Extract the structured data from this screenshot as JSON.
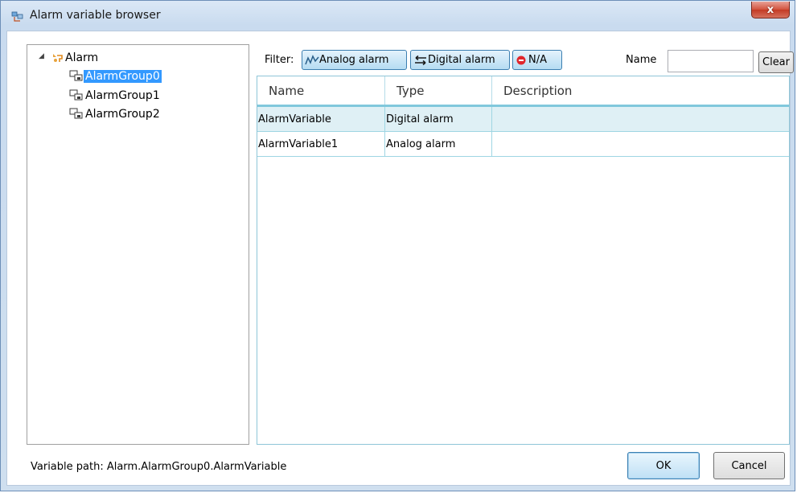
{
  "window": {
    "title": "Alarm variable browser",
    "close_label": "x"
  },
  "tree": {
    "root": {
      "label": "Alarm",
      "expander": "◢"
    },
    "items": [
      {
        "label": "AlarmGroup0",
        "selected": true
      },
      {
        "label": "AlarmGroup1",
        "selected": false
      },
      {
        "label": "AlarmGroup2",
        "selected": false
      }
    ]
  },
  "filter": {
    "label": "Filter:",
    "buttons": [
      {
        "label": "Analog alarm",
        "icon": "analog-wave-icon"
      },
      {
        "label": "Digital alarm",
        "icon": "digital-arrows-icon"
      },
      {
        "label": "N/A",
        "icon": "no-entry-icon"
      }
    ],
    "name_label": "Name",
    "name_value": "",
    "clear_label": "Clear"
  },
  "grid": {
    "columns": [
      "Name",
      "Type",
      "Description"
    ],
    "rows": [
      {
        "name": "AlarmVariable",
        "type": "Digital alarm",
        "description": "",
        "selected": true
      },
      {
        "name": "AlarmVariable1",
        "type": "Analog alarm",
        "description": "",
        "selected": false
      }
    ]
  },
  "footer": {
    "path_text": "Variable path: Alarm.AlarmGroup0.AlarmVariable",
    "ok_label": "OK",
    "cancel_label": "Cancel"
  }
}
